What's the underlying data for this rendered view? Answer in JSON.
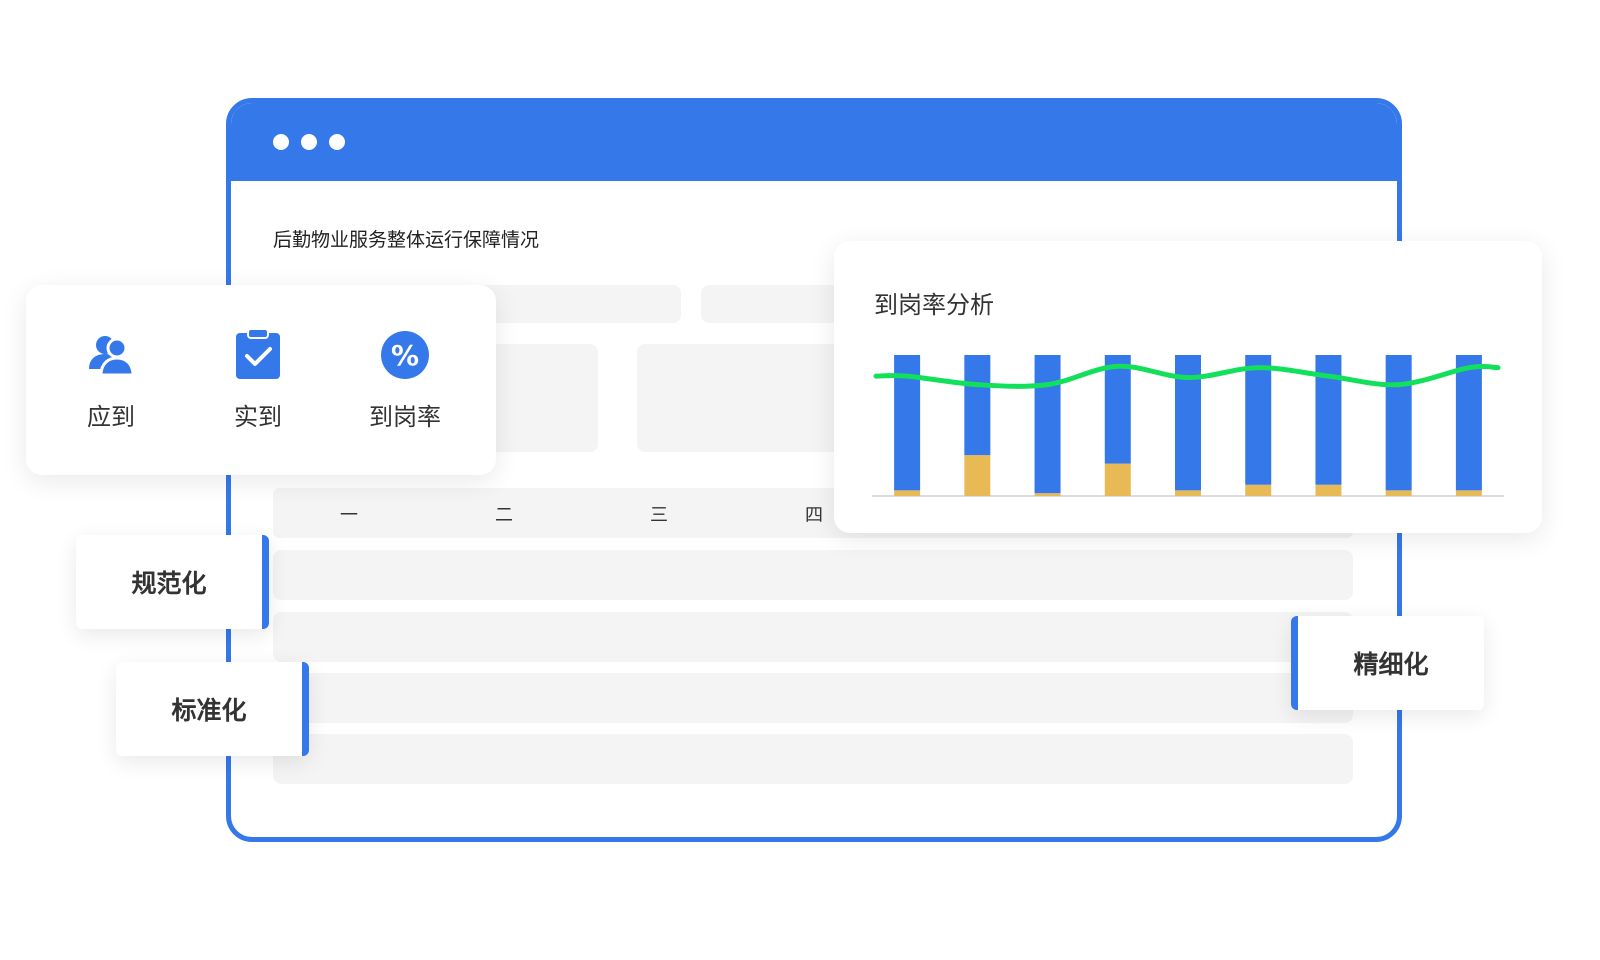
{
  "window": {
    "page_title": "后勤物业服务整体运行保障情况",
    "table_headers": [
      "一",
      "二",
      "三",
      "四"
    ]
  },
  "stats": [
    {
      "label": "应到",
      "icon": "users-icon"
    },
    {
      "label": "实到",
      "icon": "clipboard-check-icon"
    },
    {
      "label": "到岗率",
      "icon": "percent-icon"
    }
  ],
  "tags": {
    "normalize": "规范化",
    "standardize": "标准化",
    "refine": "精细化"
  },
  "colors": {
    "primary": "#3478ea",
    "bar_secondary": "#e8ba55",
    "line": "#12e05a",
    "placeholder": "#f4f4f4"
  },
  "chart_data": {
    "type": "bar",
    "title": "到岗率分析",
    "stacked": true,
    "series": [
      {
        "color": "#e8ba55",
        "values": [
          4,
          29,
          2,
          23,
          4,
          8,
          8,
          4,
          4
        ]
      },
      {
        "color": "#3478ea",
        "values": [
          96,
          71,
          98,
          77,
          96,
          92,
          92,
          96,
          96
        ]
      }
    ],
    "line": {
      "color": "#12e05a",
      "values": [
        85,
        79,
        79,
        92,
        84,
        91,
        85,
        79,
        91
      ]
    },
    "ylim": [
      0,
      100
    ],
    "grid": false,
    "legend": "none"
  }
}
